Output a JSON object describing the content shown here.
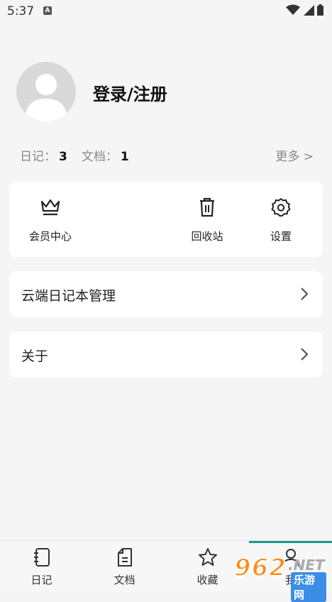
{
  "status_bar": {
    "time": "5:37",
    "app_icon_letter": "A"
  },
  "profile": {
    "login_label": "登录/注册"
  },
  "stats": {
    "diary_label": "日记：",
    "diary_count": "3",
    "doc_label": "文档：",
    "doc_count": "1",
    "more_label": "更多 >"
  },
  "quick_actions": [
    {
      "label": "会员中心",
      "icon": "crown-icon"
    },
    {
      "label": "回收站",
      "icon": "trash-icon"
    },
    {
      "label": "设置",
      "icon": "gear-icon"
    }
  ],
  "menu_rows": [
    {
      "label": "云端日记本管理"
    },
    {
      "label": "关于"
    }
  ],
  "tabs": [
    {
      "label": "日记",
      "icon": "diary-icon"
    },
    {
      "label": "文档",
      "icon": "document-icon"
    },
    {
      "label": "收藏",
      "icon": "star-icon"
    },
    {
      "label": "我",
      "icon": "person-icon",
      "active": true
    }
  ],
  "colors": {
    "accent": "#1e9a8a",
    "background": "#f5f5f5",
    "card": "#ffffff"
  },
  "watermark": {
    "digits": "962",
    "suffix": ".NET",
    "text": "乐游网"
  }
}
